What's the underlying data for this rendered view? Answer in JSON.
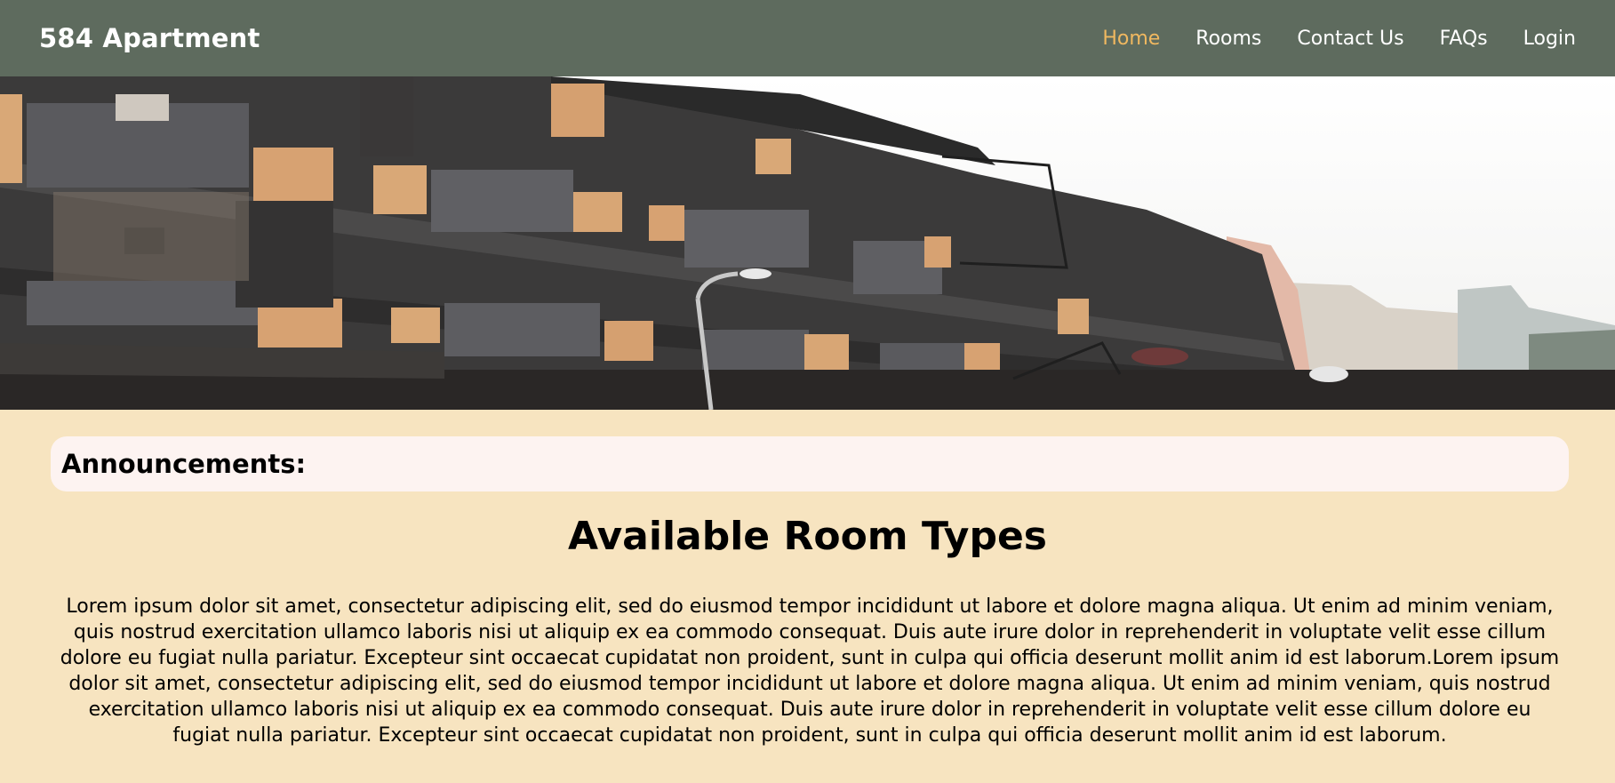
{
  "navbar": {
    "brand": "584 Apartment",
    "links": [
      {
        "label": "Home",
        "active": true
      },
      {
        "label": "Rooms",
        "active": false
      },
      {
        "label": "Contact Us",
        "active": false
      },
      {
        "label": "FAQs",
        "active": false
      },
      {
        "label": "Login",
        "active": false
      }
    ],
    "colors": {
      "background": "#5e6b5e",
      "active_link": "#f0b860",
      "link": "#ffffff"
    }
  },
  "hero": {
    "image": "apartment-building-photo"
  },
  "announcements": {
    "title": "Announcements:"
  },
  "main": {
    "title": "Available Room Types",
    "body": "Lorem ipsum dolor sit amet, consectetur adipiscing elit, sed do eiusmod tempor incididunt ut labore et dolore magna aliqua. Ut enim ad minim veniam, quis nostrud exercitation ullamco laboris nisi ut aliquip ex ea commodo consequat. Duis aute irure dolor in reprehenderit in voluptate velit esse cillum dolore eu fugiat nulla pariatur. Excepteur sint occaecat cupidatat non proident, sunt in culpa qui officia deserunt mollit anim id est laborum.Lorem ipsum dolor sit amet, consectetur adipiscing elit, sed do eiusmod tempor incididunt ut labore et dolore magna aliqua. Ut enim ad minim veniam, quis nostrud exercitation ullamco laboris nisi ut aliquip ex ea commodo consequat. Duis aute irure dolor in reprehenderit in voluptate velit esse cillum dolore eu fugiat nulla pariatur. Excepteur sint occaecat cupidatat non proident, sunt in culpa qui officia deserunt mollit anim id est laborum."
  },
  "page": {
    "background": "#f7e4c0"
  }
}
